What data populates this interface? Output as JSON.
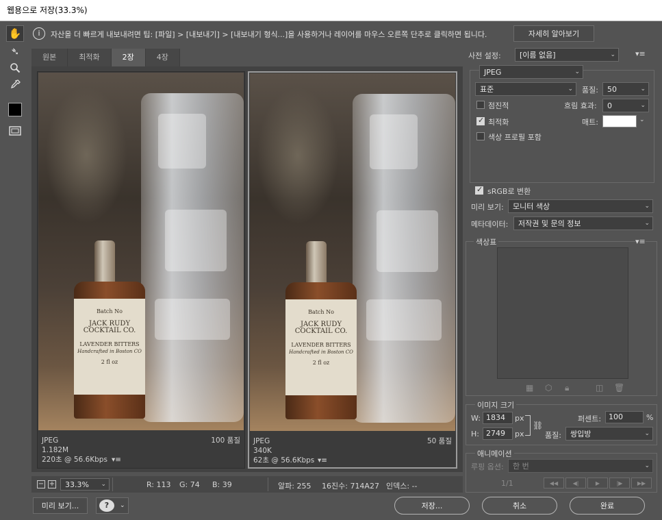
{
  "window": {
    "title": "웹용으로 저장(33.3%)"
  },
  "info": {
    "text": "자산을 더 빠르게 내보내려면 팁: [파일] > [내보내기] > [내보내기 형식...]을 사용하거나 레이어를 마우스 오른쪽 단추로 클릭하면 됩니다.",
    "learn_more": "자세히 알아보기"
  },
  "tabs": [
    "원본",
    "최적화",
    "2장",
    "4장"
  ],
  "active_tab": "2장",
  "photo": {
    "line1": "Batch No",
    "line2": "JACK RUDY",
    "line3": "COCKTAIL CO.",
    "line4": "LAVENDER BITTERS",
    "line5": "Handcrafted in Boston CO",
    "line6": "2 fl oz"
  },
  "panes": [
    {
      "format": "JPEG",
      "size": "1.182M",
      "time": "220초 @ 56.6Kbps",
      "quality": "100 품질"
    },
    {
      "format": "JPEG",
      "size": "340K",
      "time": "62초 @ 56.6Kbps",
      "quality": "50 품질"
    }
  ],
  "status": {
    "zoom": "33.3%",
    "r": "R: 113",
    "g": "G: 74",
    "b": "B: 39",
    "alpha": "알파: 255",
    "hex": "16진수: 714A27",
    "index": "인덱스: --"
  },
  "buttons": {
    "preview": "미리 보기...",
    "save": "저장...",
    "cancel": "취소",
    "done": "완료"
  },
  "settings": {
    "preset_label": "사전 설정:",
    "preset_value": "[이름 없음]",
    "format": "JPEG",
    "compression": "표준",
    "quality_label": "품질:",
    "quality_value": "50",
    "progressive": "점진적",
    "blur_label": "흐림 효과:",
    "blur_value": "0",
    "optimized": "최적화",
    "matte_label": "매트:",
    "embed_profile": "색상 프로필 포함",
    "srgb": "sRGB로 변환",
    "preview_label": "미리 보기:",
    "preview_value": "모니터 색상",
    "metadata_label": "메타데이터:",
    "metadata_value": "저작권 및 문의 정보"
  },
  "color_table": {
    "title": "색상표"
  },
  "image_size": {
    "title": "이미지 크기",
    "w_label": "W:",
    "w": "1834",
    "h_label": "H:",
    "h": "2749",
    "unit": "px",
    "percent_label": "퍼센트:",
    "percent": "100",
    "percent_unit": "%",
    "quality_label": "품질:",
    "quality": "쌍입방"
  },
  "animation": {
    "title": "애니메이션",
    "loop_label": "루핑 옵션:",
    "loop_value": "한 번",
    "frame": "1/1"
  },
  "checks": {
    "progressive": false,
    "optimized": true,
    "embed_profile": false,
    "srgb": true
  },
  "colors": {
    "matte": "#ffffff",
    "bg": "#535353"
  }
}
